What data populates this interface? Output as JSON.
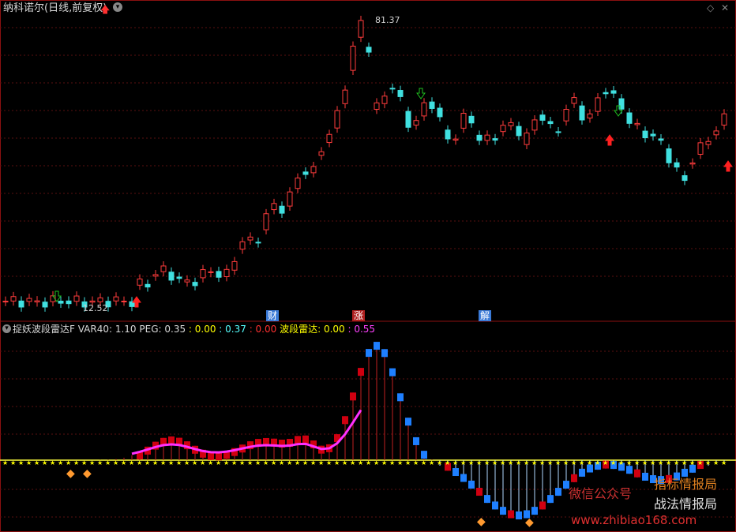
{
  "main_chart": {
    "title": "纳科诺尔(日线,前复权)",
    "high_label": "81.37",
    "low_label": "12.52",
    "events": [
      {
        "label": "财",
        "color": "#3b7bd8"
      },
      {
        "label": "涨",
        "color": "#b02020"
      },
      {
        "label": "解",
        "color": "#3b7bd8"
      }
    ]
  },
  "indicator": {
    "name": "捉妖波段雷达F",
    "values": [
      {
        "text": "VAR40: 1.10",
        "color": "#d8d8d8"
      },
      {
        "text": "PEG: 0.35",
        "color": "#d8d8d8"
      },
      {
        "text": ": 0.00",
        "color": "#ffff00"
      },
      {
        "text": ": 0.37",
        "color": "#55ffff"
      },
      {
        "text": ": 0.00",
        "color": "#ff3030"
      },
      {
        "text": "波段雷达: 0.00",
        "color": "#ffff00"
      },
      {
        "text": ": 0.55",
        "color": "#ff40ff"
      }
    ]
  },
  "watermark": {
    "line1": "微信公众号",
    "line2": "指标情报局",
    "line3": "战法情报局",
    "url": "www.zhibiao168.com"
  },
  "colors": {
    "up": "#ff3c3c",
    "down": "#40e0e0",
    "magenta": "#ff30ff",
    "yellow": "#ffff40",
    "blue_bar": "#1e7fff",
    "red_bar": "#d00010"
  }
}
